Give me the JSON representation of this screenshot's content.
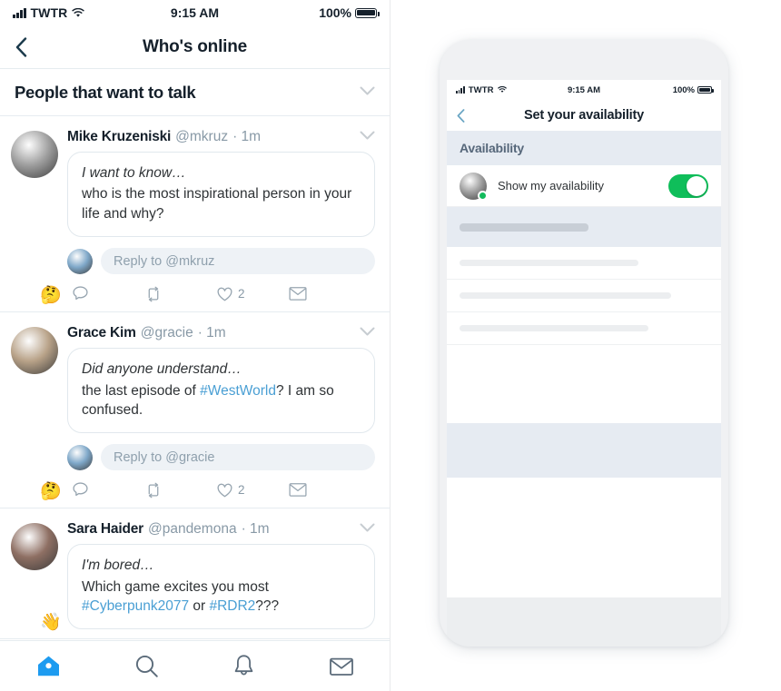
{
  "left_phone": {
    "status_bar": {
      "carrier": "TWTR",
      "time": "9:15 AM",
      "battery": "100%",
      "wifi_icon": "wifi-icon",
      "signal_icon": "signal-bars-icon",
      "battery_icon": "battery-icon"
    },
    "nav": {
      "back_icon": "chevron-left-icon",
      "title": "Who's online"
    },
    "section": {
      "title": "People that want to talk",
      "collapse_icon": "chevron-down-icon"
    },
    "tweets": [
      {
        "name": "Mike Kruzeniski",
        "handle": "@mkruz",
        "time": "1m",
        "separator": "·",
        "emoji": "🤔",
        "avatar_color": "#9aa0a6",
        "avatar_name": "avatar-mike-kruzeniski",
        "menu_icon": "chevron-down-icon",
        "prompt": "I want to know…",
        "body_parts": [
          {
            "type": "text",
            "text": "who is the most inspirational person in your life and why?"
          }
        ],
        "reply_placeholder": "Reply to @mkruz",
        "reply_avatar_color": "#7fa8c9",
        "actions": {
          "reply_icon": "reply-bubble-icon",
          "retweet_icon": "retweet-icon",
          "like_icon": "heart-icon",
          "like_count": "2",
          "share_icon": "envelope-icon"
        }
      },
      {
        "name": "Grace Kim",
        "handle": "@gracie",
        "time": "1m",
        "separator": "·",
        "emoji": "🤔",
        "avatar_color": "#b8a288",
        "avatar_name": "avatar-grace-kim",
        "menu_icon": "chevron-down-icon",
        "prompt": "Did anyone understand…",
        "body_parts": [
          {
            "type": "text",
            "text": "the last episode of "
          },
          {
            "type": "hashtag",
            "text": "#WestWorld"
          },
          {
            "type": "text",
            "text": "? I am so confused."
          }
        ],
        "reply_placeholder": "Reply to @gracie",
        "reply_avatar_color": "#7fa8c9",
        "actions": {
          "reply_icon": "reply-bubble-icon",
          "retweet_icon": "retweet-icon",
          "like_icon": "heart-icon",
          "like_count": "2",
          "share_icon": "envelope-icon"
        }
      },
      {
        "name": "Sara Haider",
        "handle": "@pandemona",
        "time": "1m",
        "separator": "·",
        "emoji": "👋",
        "avatar_color": "#8e6f63",
        "avatar_name": "avatar-sara-haider",
        "menu_icon": "chevron-down-icon",
        "prompt": "I'm bored…",
        "body_parts": [
          {
            "type": "text",
            "text": "Which game excites you most "
          },
          {
            "type": "hashtag",
            "text": "#Cyberpunk2077"
          },
          {
            "type": "text",
            "text": " or "
          },
          {
            "type": "hashtag",
            "text": "#RDR2"
          },
          {
            "type": "text",
            "text": "???"
          }
        ],
        "reply_placeholder": "",
        "reply_avatar_color": "#7fa8c9",
        "actions": {}
      }
    ],
    "tabbar": [
      {
        "name": "tab-home",
        "icon": "home-icon",
        "active": true
      },
      {
        "name": "tab-search",
        "icon": "search-icon",
        "active": false
      },
      {
        "name": "tab-notifications",
        "icon": "bell-icon",
        "active": false
      },
      {
        "name": "tab-messages",
        "icon": "envelope-icon",
        "active": false
      }
    ],
    "colors": {
      "accent": "#1d9bf0",
      "link": "#4a9fd4",
      "muted": "#8899a6",
      "text": "#15202b"
    }
  },
  "right_phone": {
    "status_bar": {
      "carrier": "TWTR",
      "time": "9:15 AM",
      "battery": "100%"
    },
    "nav": {
      "back_icon": "chevron-left-icon",
      "title": "Set your availability"
    },
    "section": {
      "title": "Availability"
    },
    "row": {
      "label": "Show my availability",
      "avatar_name": "avatar-current-user",
      "avatar_color": "#9aa0a6",
      "online_indicator": "online-dot",
      "toggle_state": "on",
      "toggle_color": "#0fbe5a"
    },
    "skeleton_rows": [
      {
        "width": "52%",
        "tone": "dark"
      },
      {
        "width": "72%",
        "tone": "light"
      },
      {
        "width": "85%",
        "tone": "light"
      },
      {
        "width": "76%",
        "tone": "light"
      }
    ],
    "colors": {
      "section_bg": "#e6ebf2",
      "section_text": "#56677a",
      "frame": "#f0f1f3"
    }
  }
}
